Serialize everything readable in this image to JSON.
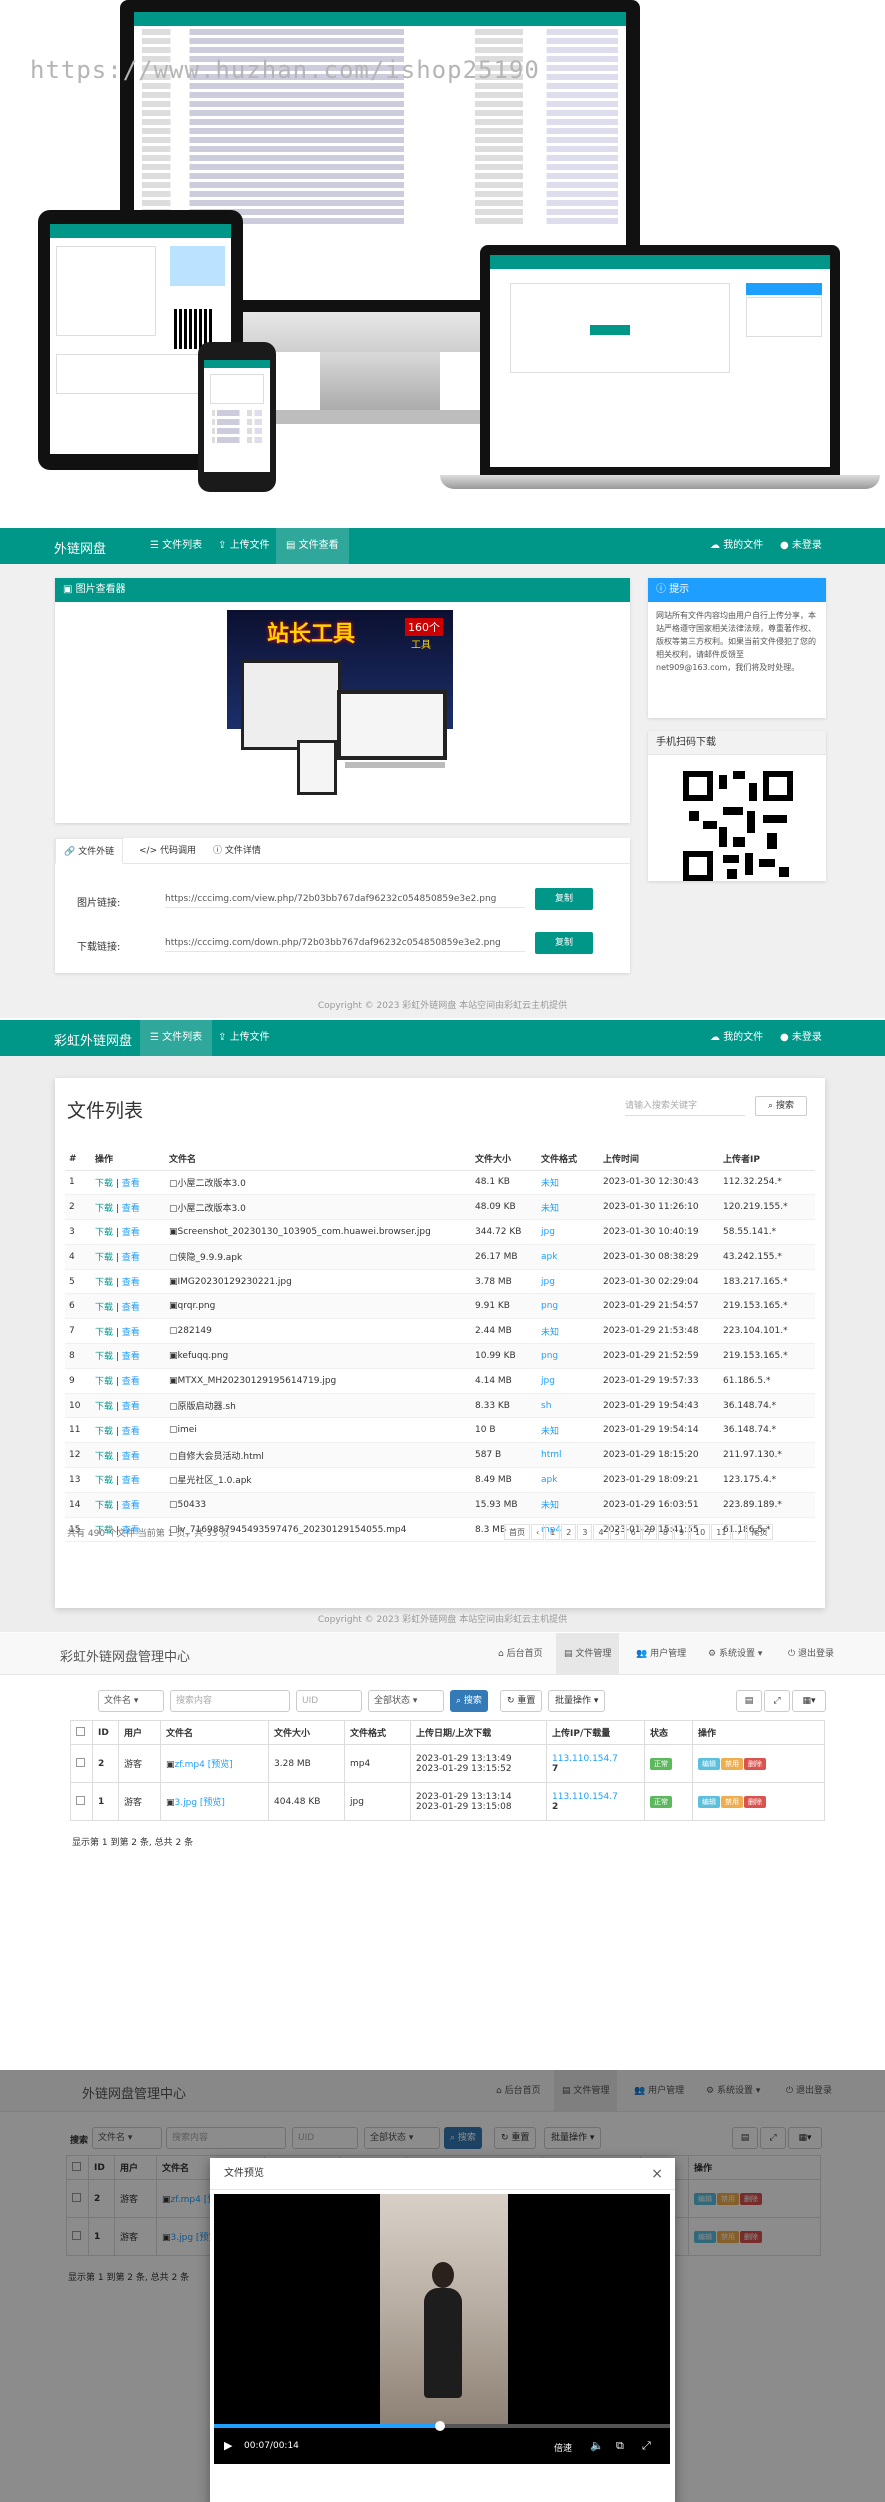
{
  "hero": {
    "watermark": "https://www.huzhan.com/ishop25190"
  },
  "view": {
    "brand": "外链网盘",
    "nav": [
      "文件列表",
      "上传文件",
      "文件查看"
    ],
    "nav_right": [
      "我的文件",
      "未登录"
    ],
    "viewer_title": "图片查看器",
    "promo_text": "站长工具",
    "promo_badge": "160个",
    "promo_badge2": "工具",
    "tabs": [
      "文件外链",
      "代码调用",
      "文件详情"
    ],
    "img_link_label": "图片链接:",
    "img_link": "https://cccimg.com/view.php/72b03bb767daf96232c054850859e3e2.png",
    "dl_link_label": "下载链接:",
    "dl_link": "https://cccimg.com/down.php/72b03bb767daf96232c054850859e3e2.png",
    "copy_btn": "复制",
    "notice_title": "提示",
    "notice_text": "网站所有文件内容均由用户自行上传分享，本站严格遵守国家相关法律法规，尊重著作权、版权等第三方权利。如果当前文件侵犯了您的相关权利，请邮件反馈至net909@163.com，我们将及时处理。",
    "qr_title": "手机扫码下载",
    "footer": "Copyright © 2023 彩虹外链网盘 本站空间由彩虹云主机提供"
  },
  "list": {
    "brand": "彩虹外链网盘",
    "nav": [
      "文件列表",
      "上传文件"
    ],
    "nav_right": [
      "我的文件",
      "未登录"
    ],
    "title": "文件列表",
    "search_placeholder": "请输入搜索关键字",
    "search_btn": "搜索",
    "headers": [
      "#",
      "操作",
      "文件名",
      "文件大小",
      "文件格式",
      "上传时间",
      "上传者IP"
    ],
    "op_dl": "下载",
    "op_view": "查看",
    "rows": [
      [
        "1",
        "小屋二改版本3.0",
        "48.1 KB",
        "未知",
        "2023-01-30 12:30:43",
        "112.32.254.*"
      ],
      [
        "2",
        "小屋二改版本3.0",
        "48.09 KB",
        "未知",
        "2023-01-30 11:26:10",
        "120.219.155.*"
      ],
      [
        "3",
        "Screenshot_20230130_103905_com.huawei.browser.jpg",
        "344.72 KB",
        "jpg",
        "2023-01-30 10:40:19",
        "58.55.141.*"
      ],
      [
        "4",
        "侠隐_9.9.9.apk",
        "26.17 MB",
        "apk",
        "2023-01-30 08:38:29",
        "43.242.155.*"
      ],
      [
        "5",
        "IMG20230129230221.jpg",
        "3.78 MB",
        "jpg",
        "2023-01-30 02:29:04",
        "183.217.165.*"
      ],
      [
        "6",
        "qrqr.png",
        "9.91 KB",
        "png",
        "2023-01-29 21:54:57",
        "219.153.165.*"
      ],
      [
        "7",
        "282149",
        "2.44 MB",
        "未知",
        "2023-01-29 21:53:48",
        "223.104.101.*"
      ],
      [
        "8",
        "kefuqq.png",
        "10.99 KB",
        "png",
        "2023-01-29 21:52:59",
        "219.153.165.*"
      ],
      [
        "9",
        "MTXX_MH20230129195614719.jpg",
        "4.14 MB",
        "jpg",
        "2023-01-29 19:57:33",
        "61.186.5.*"
      ],
      [
        "10",
        "原版启动器.sh",
        "8.33 KB",
        "sh",
        "2023-01-29 19:54:43",
        "36.148.74.*"
      ],
      [
        "11",
        "imei",
        "10 B",
        "未知",
        "2023-01-29 19:54:14",
        "36.148.74.*"
      ],
      [
        "12",
        "自修大会员活动.html",
        "587 B",
        "html",
        "2023-01-29 18:15:20",
        "211.97.130.*"
      ],
      [
        "13",
        "星光社区_1.0.apk",
        "8.49 MB",
        "apk",
        "2023-01-29 18:09:21",
        "123.175.4.*"
      ],
      [
        "14",
        "50433",
        "15.93 MB",
        "未知",
        "2023-01-29 16:03:51",
        "223.89.189.*"
      ],
      [
        "15",
        "lv_7169887945493597476_20230129154055.mp4",
        "8.3 MB",
        "mp4",
        "2023-01-29 15:41:55",
        "61.186.5.*"
      ]
    ],
    "summary": "共有 490 个文件  当前第 1 页，共 33 页",
    "pages": [
      "首页",
      "‹",
      "1",
      "2",
      "3",
      "4",
      "5",
      "6",
      "7",
      "8",
      "9",
      "10",
      "11",
      "›",
      "尾页"
    ],
    "footer": "Copyright © 2023 彩虹外链网盘 本站空间由彩虹云主机提供"
  },
  "admin": {
    "brand": "彩虹外链网盘管理中心",
    "nav": [
      "后台首页",
      "文件管理",
      "用户管理",
      "系统设置",
      "退出登录"
    ],
    "filter_name": "文件名",
    "search_placeholder": "搜索内容",
    "uid_placeholder": "UID",
    "status": "全部状态",
    "search_btn": "搜索",
    "reset_btn": "重置",
    "batch_btn": "批量操作",
    "headers": [
      "ID",
      "用户",
      "文件名",
      "文件大小",
      "文件格式",
      "上传日期/上次下载",
      "上传IP/下载量",
      "状态",
      "操作"
    ],
    "preview": "[预览]",
    "rows": [
      {
        "id": "2",
        "user": "游客",
        "file": "zf.mp4",
        "size": "3.28 MB",
        "fmt": "mp4",
        "d1": "2023-01-29 13:13:49",
        "d2": "2023-01-29 13:15:52",
        "ip": "113.110.154.7",
        "cnt": "7"
      },
      {
        "id": "1",
        "user": "游客",
        "file": "3.jpg",
        "size": "404.48 KB",
        "fmt": "jpg",
        "d1": "2023-01-29 13:13:14",
        "d2": "2023-01-29 13:15:08",
        "ip": "113.110.154.7",
        "cnt": "2"
      }
    ],
    "status_tag": "正常",
    "ops": [
      "编辑",
      "禁用",
      "删除"
    ],
    "summary": "显示第 1 到第 2 条, 总共 2 条"
  },
  "admin2": {
    "brand": "外链网盘管理中心",
    "modal_title": "文件预览",
    "time": "00:07/00:14",
    "speed": "倍速"
  },
  "colors": {
    "teal": "#009688",
    "blue": "#1e9fff",
    "admin_blue": "#337ab7"
  }
}
